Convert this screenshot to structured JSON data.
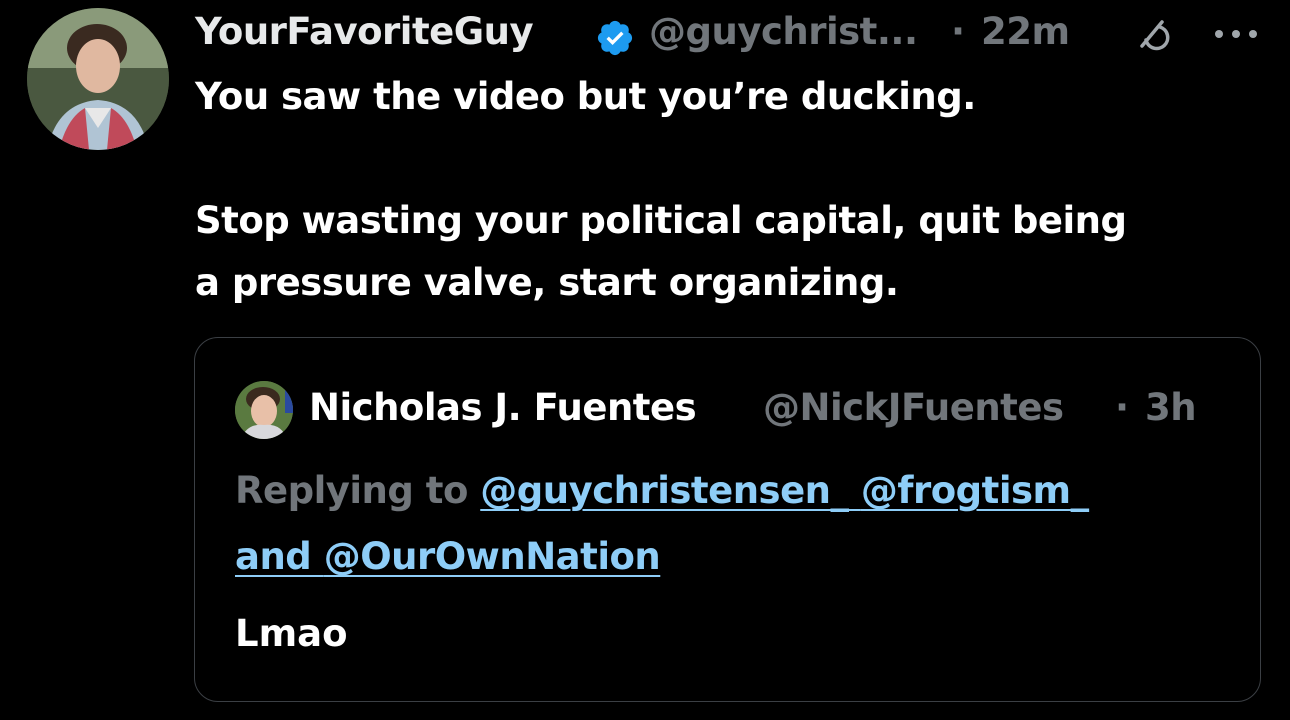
{
  "tweet": {
    "display_name": "YourFavoriteGuy",
    "handle": "@guychrist...",
    "separator": "·",
    "time": "22m",
    "verified_icon": "verified-badge-icon",
    "grok_icon": "grok-icon",
    "more_icon": "more-options-icon",
    "text_paragraph_1": "You saw the video but you’re ducking.",
    "text_paragraph_2": "Stop wasting your political capital, quit being\na pressure valve, start organizing."
  },
  "quote": {
    "display_name": "Nicholas J. Fuentes",
    "handle": "@NickJFuentes",
    "separator": "·",
    "time": "3h",
    "replying_prefix": "Replying to ",
    "mention_1": "@guychristensen_",
    "mention_2": "@frogtism_",
    "conjunction": "and ",
    "mention_3": "@OurOwnNation",
    "body": "Lmao"
  },
  "colors": {
    "background": "#000000",
    "primary_text": "#ffffff",
    "secondary_text": "#71767b",
    "link": "#8ecdf7",
    "verified": "#1d9bf0",
    "border": "#3b3f44"
  }
}
